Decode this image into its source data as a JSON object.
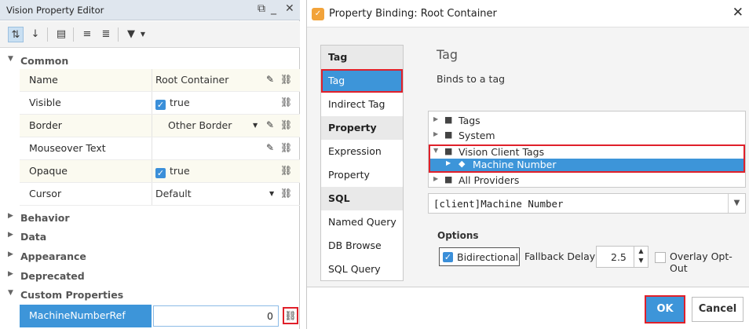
{
  "editor": {
    "title": "Vision Property Editor",
    "window_controls": [
      "⧉",
      "_",
      "✕"
    ],
    "toolbar_icons": [
      "sort-category-icon",
      "sort-alpha-icon",
      "list-icon",
      "expand-all-icon",
      "collapse-all-icon",
      "filter-icon"
    ],
    "categories": {
      "common": "Common",
      "behavior": "Behavior",
      "data": "Data",
      "appearance": "Appearance",
      "deprecated": "Deprecated",
      "custom": "Custom Properties"
    },
    "properties": [
      {
        "name": "Name",
        "value": "Root Container"
      },
      {
        "name": "Visible",
        "value": "true"
      },
      {
        "name": "Border",
        "value": "Other Border"
      },
      {
        "name": "Mouseover Text",
        "value": ""
      },
      {
        "name": "Opaque",
        "value": "true"
      },
      {
        "name": "Cursor",
        "value": "Default"
      }
    ],
    "custom_property": {
      "name": "MachineNumberRef",
      "value": "0"
    }
  },
  "dialog": {
    "title": "Property Binding: Root Container",
    "binding_groups": {
      "tag_header": "Tag",
      "tag": "Tag",
      "indirect_tag": "Indirect Tag",
      "property_header": "Property",
      "expression": "Expression",
      "property": "Property",
      "sql_header": "SQL",
      "named_query": "Named Query",
      "db_browse": "DB Browse",
      "sql_query": "SQL Query"
    },
    "config_title": "Tag",
    "config_description": "Binds to a tag",
    "tree": [
      "Tags",
      "System",
      "Vision Client Tags",
      "Machine Number",
      "All Providers"
    ],
    "tag_path": "[client]Machine Number",
    "options_label": "Options",
    "bidirectional_label": "Bidirectional",
    "bidirectional_checked": true,
    "fallback_label": "Fallback Delay",
    "fallback_value": "2.5",
    "overlay_label": "Overlay Opt-Out",
    "ok_label": "OK",
    "cancel_label": "Cancel"
  },
  "colors": {
    "selection": "#3d95d9",
    "highlight": "#e0202a"
  }
}
